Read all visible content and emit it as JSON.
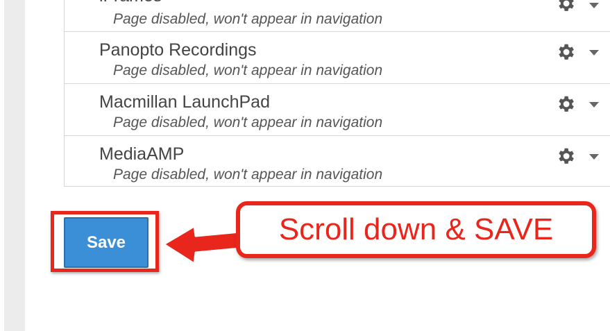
{
  "nav_items": [
    {
      "title": "iFrames",
      "status": "Page disabled, won't appear in navigation"
    },
    {
      "title": "Panopto Recordings",
      "status": "Page disabled, won't appear in navigation"
    },
    {
      "title": "Macmillan LaunchPad",
      "status": "Page disabled, won't appear in navigation"
    },
    {
      "title": "MediaAMP",
      "status": "Page disabled, won't appear in navigation"
    }
  ],
  "save_label": "Save",
  "callout_text": "Scroll down & SAVE",
  "colors": {
    "accent_red": "#e8261b",
    "button_blue": "#3b8fd6",
    "gear": "#555555"
  },
  "icons": [
    "gear-icon",
    "caret-down-icon",
    "arrow-left-icon"
  ]
}
